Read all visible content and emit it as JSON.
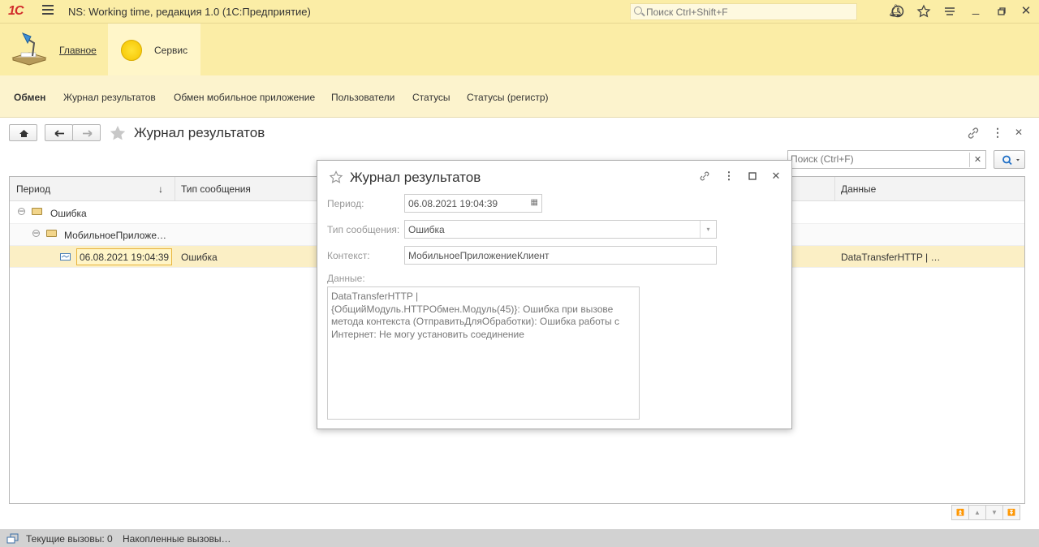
{
  "app": {
    "title": "NS: Working time, редакция 1.0  (1С:Предприятие)",
    "search_placeholder": "Поиск Ctrl+Shift+F"
  },
  "sections": {
    "main": "Главное",
    "service": "Сервис"
  },
  "nav": [
    "Обмен",
    "Журнал результатов",
    "Обмен мобильное приложение",
    "Пользователи",
    "Статусы",
    "Статусы (регистр)"
  ],
  "form": {
    "title": "Журнал результатов",
    "search_placeholder": "Поиск (Ctrl+F)",
    "columns": {
      "period": "Период",
      "type": "Тип сообщения",
      "data": "Данные"
    },
    "rows": {
      "group1": "Ошибка",
      "group2": "МобильноеПриложе…",
      "record": {
        "period": "06.08.2021 19:04:39",
        "type": "Ошибка",
        "data": "DataTransferHTTP | …"
      }
    }
  },
  "dialog": {
    "title": "Журнал результатов",
    "period_label": "Период:",
    "period_value": "06.08.2021 19:04:39",
    "type_label": "Тип сообщения:",
    "type_value": "Ошибка",
    "context_label": "Контекст:",
    "context_value": "МобильноеПриложениеКлиент",
    "data_label": "Данные:",
    "data_lines": [
      "DataTransferHTTP |",
      "{ОбщийМодуль.HTTPОбмен.Модуль(45)}: Ошибка при вызове",
      "метода контекста (ОтправитьДляОбработки): Ошибка работы с",
      "Интернет:  Не могу установить соединение"
    ]
  },
  "statusbar": {
    "current": "Текущие вызовы: 0",
    "accumulated": "Накопленные вызовы…"
  }
}
